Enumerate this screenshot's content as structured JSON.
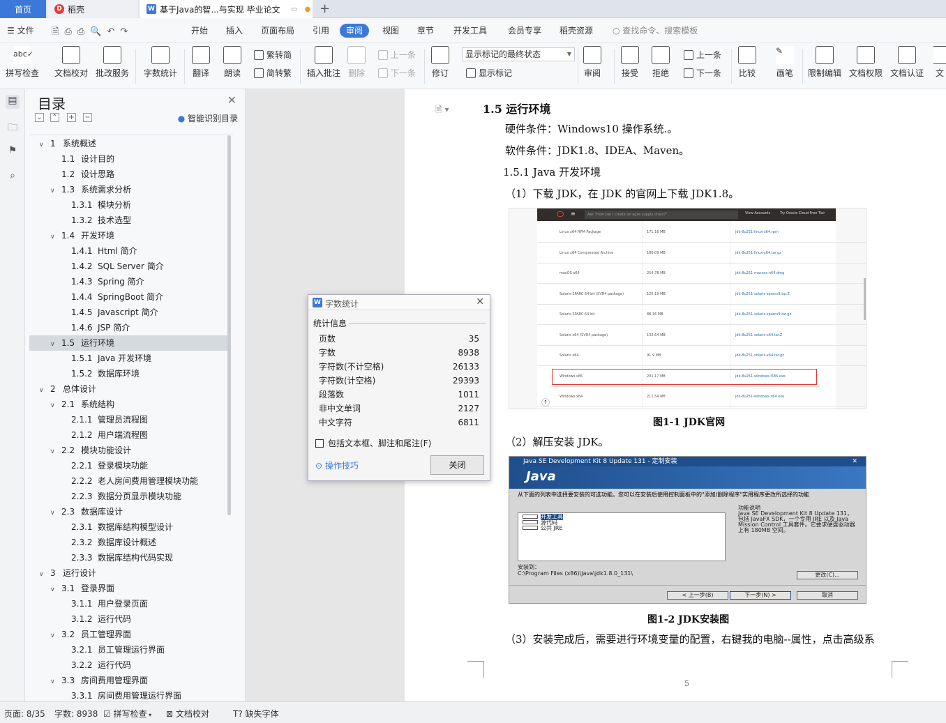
{
  "tabs": {
    "home": "首页",
    "docer": "稻壳",
    "doc": "基于Java的智...与实现 毕业论文",
    "add": "+"
  },
  "menu": {
    "file": "文件",
    "items": [
      "开始",
      "插入",
      "页面布局",
      "引用",
      "审阅",
      "视图",
      "章节",
      "开发工具",
      "会员专享",
      "稻壳资源"
    ],
    "search": "查找命令、搜索模板"
  },
  "ribbon": {
    "spellcheck": "拼写检查",
    "doccheck": "文档校对",
    "batch": "批改服务",
    "wordcount": "字数统计",
    "translate": "翻译",
    "read": "朗读",
    "t2s": "繁转简",
    "s2t": "简转繁",
    "insert_comment": "插入批注",
    "delete": "删除",
    "prev": "上一条",
    "next": "下一条",
    "revise": "修订",
    "markup_state": "显示标记的最终状态",
    "show_markup": "显示标记",
    "review": "审阅",
    "accept": "接受",
    "reject": "拒绝",
    "prev2": "上一条",
    "next2": "下一条",
    "compare": "比较",
    "ink": "画笔",
    "restrict": "限制编辑",
    "permission": "文档权限",
    "certify": "文档认证",
    "more": "文"
  },
  "toc": {
    "title": "目录",
    "smart": "智能识别目录",
    "items": [
      {
        "level": 1,
        "num": "1",
        "text": "系统概述",
        "arrow": true
      },
      {
        "level": 2,
        "num": "1.1",
        "text": "设计目的"
      },
      {
        "level": 2,
        "num": "1.2",
        "text": "设计思路"
      },
      {
        "level": 2,
        "num": "1.3",
        "text": "系统需求分析",
        "arrow": true
      },
      {
        "level": 3,
        "num": "1.3.1",
        "text": "模块分析"
      },
      {
        "level": 3,
        "num": "1.3.2",
        "text": "技术选型"
      },
      {
        "level": 2,
        "num": "1.4",
        "text": "开发环境",
        "arrow": true
      },
      {
        "level": 3,
        "num": "1.4.1",
        "text": "Html 简介"
      },
      {
        "level": 3,
        "num": "1.4.2",
        "text": "SQL Server 简介"
      },
      {
        "level": 3,
        "num": "1.4.3",
        "text": "Spring 简介"
      },
      {
        "level": 3,
        "num": "1.4.4",
        "text": "SpringBoot 简介"
      },
      {
        "level": 3,
        "num": "1.4.5",
        "text": "Javascript 简介"
      },
      {
        "level": 3,
        "num": "1.4.6",
        "text": "JSP 简介"
      },
      {
        "level": 2,
        "num": "1.5",
        "text": "运行环境",
        "arrow": true,
        "selected": true
      },
      {
        "level": 3,
        "num": "1.5.1",
        "text": "Java 开发环境"
      },
      {
        "level": 3,
        "num": "1.5.2",
        "text": "数据库环境"
      },
      {
        "level": 1,
        "num": "2",
        "text": "总体设计",
        "arrow": true
      },
      {
        "level": 2,
        "num": "2.1",
        "text": "系统结构",
        "arrow": true
      },
      {
        "level": 3,
        "num": "2.1.1",
        "text": "管理员流程图"
      },
      {
        "level": 3,
        "num": "2.1.2",
        "text": "用户端流程图"
      },
      {
        "level": 2,
        "num": "2.2",
        "text": "模块功能设计",
        "arrow": true
      },
      {
        "level": 3,
        "num": "2.2.1",
        "text": "登录模块功能"
      },
      {
        "level": 3,
        "num": "2.2.2",
        "text": "老人房间费用管理模块功能"
      },
      {
        "level": 3,
        "num": "2.2.3",
        "text": "数据分页显示模块功能"
      },
      {
        "level": 2,
        "num": "2.3",
        "text": "数据库设计",
        "arrow": true
      },
      {
        "level": 3,
        "num": "2.3.1",
        "text": "数据库结构模型设计"
      },
      {
        "level": 3,
        "num": "2.3.2",
        "text": "数据库设计概述"
      },
      {
        "level": 3,
        "num": "2.3.3",
        "text": "数据库结构代码实现"
      },
      {
        "level": 1,
        "num": "3",
        "text": "运行设计",
        "arrow": true
      },
      {
        "level": 2,
        "num": "3.1",
        "text": "登录界面",
        "arrow": true
      },
      {
        "level": 3,
        "num": "3.1.1",
        "text": "用户登录页面"
      },
      {
        "level": 3,
        "num": "3.1.2",
        "text": "运行代码"
      },
      {
        "level": 2,
        "num": "3.2",
        "text": "员工管理界面",
        "arrow": true
      },
      {
        "level": 3,
        "num": "3.2.1",
        "text": "员工管理运行界面"
      },
      {
        "level": 3,
        "num": "3.2.2",
        "text": "运行代码"
      },
      {
        "level": 2,
        "num": "3.3",
        "text": "房间费用管理界面",
        "arrow": true
      },
      {
        "level": 3,
        "num": "3.3.1",
        "text": "房间费用管理运行界面"
      }
    ]
  },
  "document": {
    "heading": "1.5   运行环境",
    "hw": "硬件条件：Windows10 操作系统.。",
    "sw": "软件条件：JDK1.8、IDEA、Maven。",
    "sub": "1.5.1   Java 开发环境",
    "step1": "（1）下载 JDK，在 JDK 的官网上下载 JDK1.8。",
    "cap1": "图1-1 JDK官网",
    "step2": "（2）解压安装 JDK。",
    "cap2": "图1-2 JDK安装图",
    "step3": "（3）安装完成后，需要进行环境变量的配置，右键我的电脑--属性，点击高级系",
    "page_no": "5"
  },
  "fig1": {
    "search": "Ask \"How can I create an agile supply chain?\"",
    "view_accounts": "View Accounts",
    "try_free": "Try Oracle Cloud Free Tier",
    "rows": [
      {
        "name": "Linux x64 RPM Package",
        "size": "171.16 MB",
        "file": "jdk-8u251-linux-x64.rpm"
      },
      {
        "name": "Linux x64 Compressed Archive",
        "size": "186.09 MB",
        "file": "jdk-8u251-linux-x64.tar.gz"
      },
      {
        "name": "macOS x64",
        "size": "254.78 MB",
        "file": "jdk-8u251-macosx-x64.dmg"
      },
      {
        "name": "Solaris SPARC 64-bit (SVR4 package)",
        "size": "125.19 MB",
        "file": "jdk-8u251-solaris-sparcv9.tar.Z"
      },
      {
        "name": "Solaris SPARC 64-bit",
        "size": "88.16 MB",
        "file": "jdk-8u251-solaris-sparcv9.tar.gz"
      },
      {
        "name": "Solaris x64 (SVR4 package)",
        "size": "133.64 MB",
        "file": "jdk-8u251-solaris-x64.tar.Z"
      },
      {
        "name": "Solaris x64",
        "size": "91.9 MB",
        "file": "jdk-8u251-solaris-x64.tar.gz"
      },
      {
        "name": "Windows x86",
        "size": "201.17 MB",
        "file": "jdk-8u251-windows-i586.exe",
        "highlight": true
      },
      {
        "name": "Windows x64",
        "size": "211.54 MB",
        "file": "jdk-8u251-windows-x64.exe"
      }
    ]
  },
  "fig2": {
    "title": "Java SE Development Kit 8 Update 131 - 定制安装",
    "logo": "Java",
    "instr": "从下面的列表中选择要安装的可选功能。您可以在安装后使用控制面板中的\"添加/删除程序\"实用程序更改所选择的功能",
    "features": [
      "开发工具",
      "源代码",
      "公共 JRE"
    ],
    "desc_title": "功能说明",
    "desc": "Java SE Development Kit 8 Update 131，包括 JavaFX SDK，一个专用 JRE 以及 Java Mission Control 工具套件。它要求硬盘驱动器上有 180MB 空间。",
    "install_to": "安装到：",
    "path": "C:\\Program Files (x86)\\Java\\jdk1.8.0_131\\",
    "change": "更改(C)...",
    "back": "< 上一步(B)",
    "next": "下一步(N) >",
    "cancel": "取消"
  },
  "dialog": {
    "title": "字数统计",
    "section": "统计信息",
    "rows": [
      {
        "label": "页数",
        "value": "35"
      },
      {
        "label": "字数",
        "value": "8938"
      },
      {
        "label": "字符数(不计空格)",
        "value": "26133"
      },
      {
        "label": "字符数(计空格)",
        "value": "29393"
      },
      {
        "label": "段落数",
        "value": "1011"
      },
      {
        "label": "非中文单词",
        "value": "2127"
      },
      {
        "label": "中文字符",
        "value": "6811"
      }
    ],
    "checkbox": "包括文本框、脚注和尾注(F)",
    "tips": "操作技巧",
    "close": "关闭"
  },
  "status": {
    "page": "页面: 8/35",
    "words": "字数: 8938",
    "spell": "拼写检查",
    "proof": "文档校对",
    "missing_font": "缺失字体"
  },
  "colors": {
    "accent": "#3c78d8",
    "highlight_border": "#e53935",
    "java_blue": "#1f4e8c"
  }
}
